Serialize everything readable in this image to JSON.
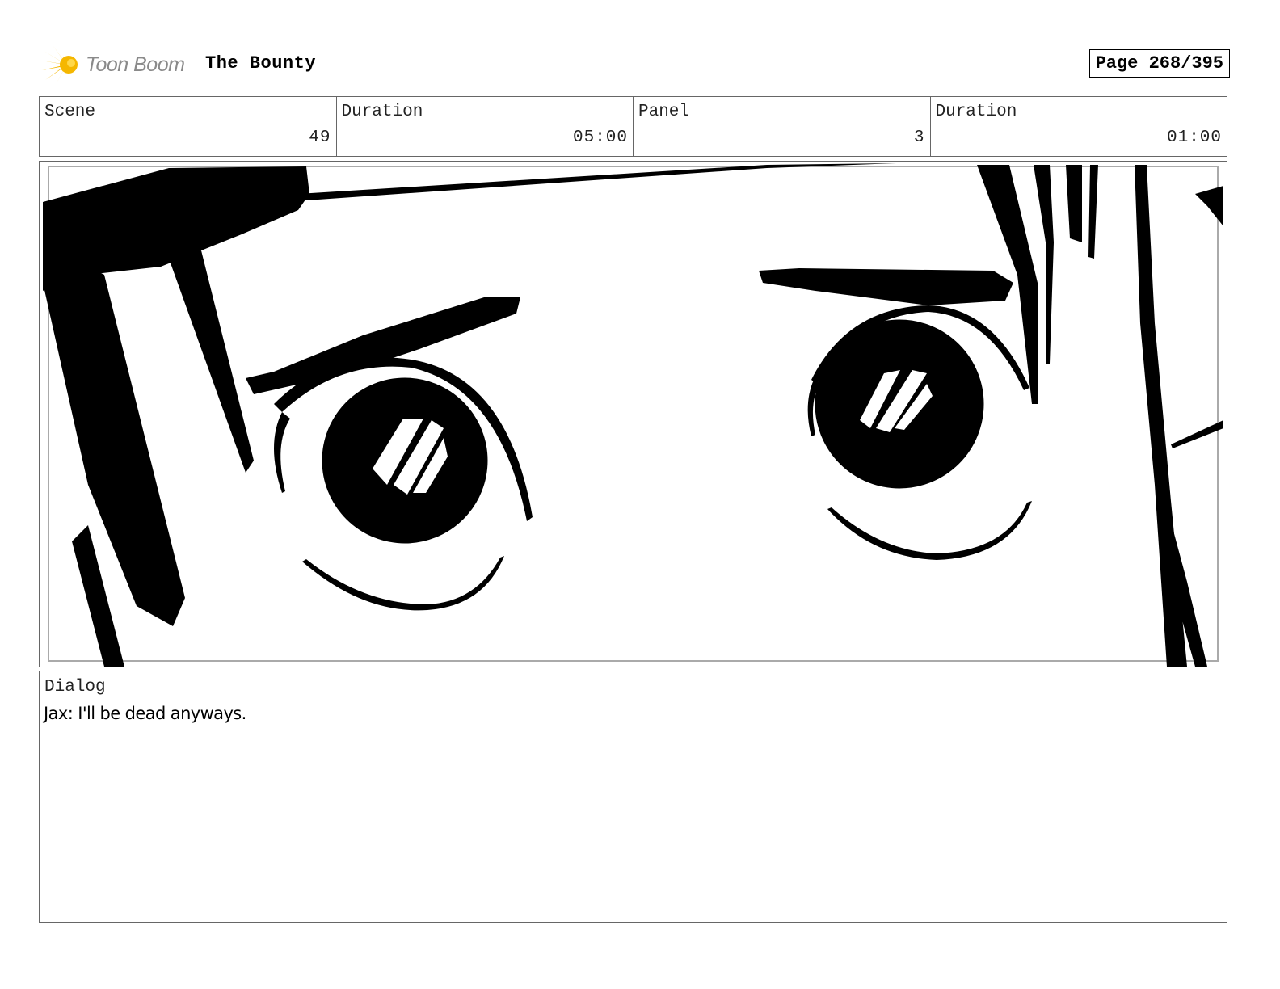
{
  "header": {
    "logo_text": "Toon Boom",
    "title": "The Bounty",
    "page": "Page 268/395"
  },
  "info": [
    {
      "label": "Scene",
      "value": "49"
    },
    {
      "label": "Duration",
      "value": "05:00"
    },
    {
      "label": "Panel",
      "value": "3"
    },
    {
      "label": "Duration",
      "value": "01:00"
    }
  ],
  "dialog": {
    "label": "Dialog",
    "text": "Jax: I'll be dead anyways."
  },
  "colors": {
    "logo_accent": "#f5b700",
    "logo_text": "#8a8a8a",
    "border": "#666666"
  }
}
